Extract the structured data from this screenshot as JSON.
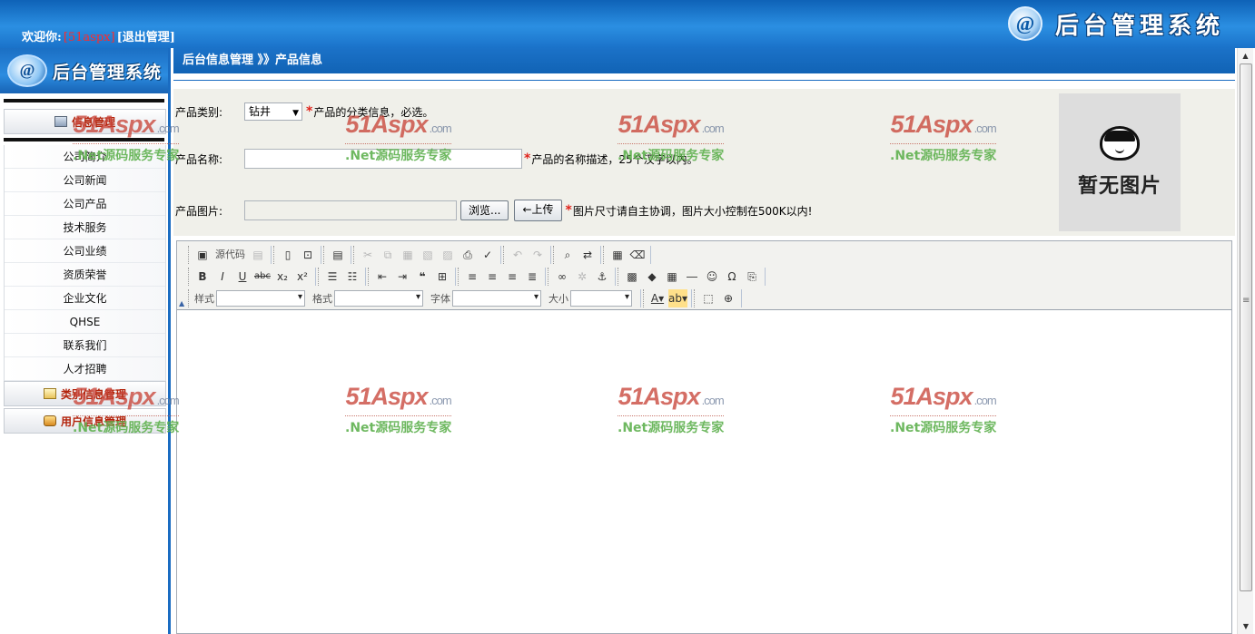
{
  "header": {
    "welcome": "欢迎你:",
    "username": "[51aspx]",
    "logout": "[退出管理]",
    "logo_mark": "@",
    "logo_text": "后台管理系统"
  },
  "sidebar": {
    "logo_mark": "@",
    "logo_text": "后台管理系统",
    "section_info": "信息管理",
    "items": [
      "公司简介",
      "公司新闻",
      "公司产品",
      "技术服务",
      "公司业绩",
      "资质荣誉",
      "企业文化",
      "QHSE",
      "联系我们",
      "人才招聘"
    ],
    "section_category": "类别信息管理",
    "section_user": "用户信息管理"
  },
  "breadcrumb": "后台信息管理 》》产品信息",
  "form": {
    "category_label": "产品类别:",
    "category_value": "钻井",
    "category_hint": "产品的分类信息，必选。",
    "name_label": "产品名称:",
    "name_value": "",
    "name_hint": "产品的名称描述，25个汉字以内。",
    "image_label": "产品图片:",
    "browse_button": "浏览...",
    "upload_button": "←上传",
    "image_hint": "图片尺寸请自主协调，图片大小控制在500K以内!",
    "required_mark": "*",
    "no_image_text": "暂无图片"
  },
  "editor": {
    "source_label": "源代码",
    "style_label": "样式",
    "format_label": "格式",
    "font_label": "字体",
    "size_label": "大小"
  },
  "watermark": {
    "brand": "51Aspx",
    "domain": ".com",
    "slogan": ".Net源码服务专家"
  }
}
